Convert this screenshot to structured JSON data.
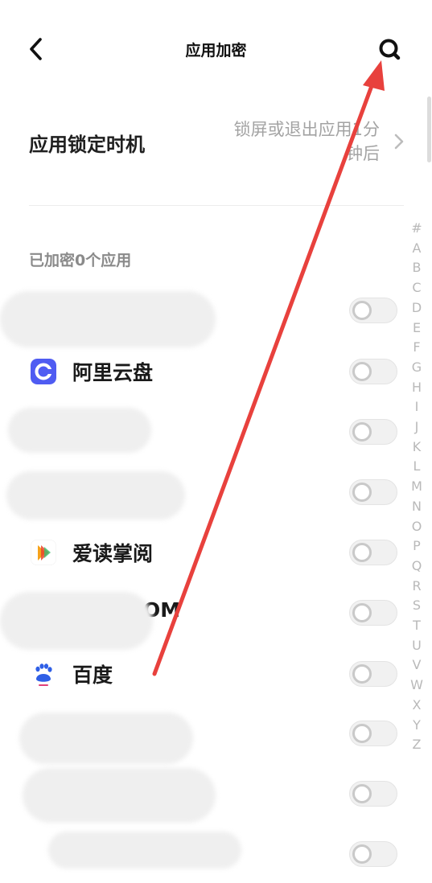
{
  "header": {
    "title": "应用加密",
    "back_icon": "chevron-left-icon",
    "search_icon": "search-icon"
  },
  "lock_timing": {
    "label": "应用锁定时机",
    "value": "锁屏或退出应用1分钟后",
    "value_line1": "锁屏或退出应用1分",
    "value_line2": "钟后"
  },
  "section": {
    "title": "已加密0个应用"
  },
  "apps": [
    {
      "label": "",
      "icon": "green-app-icon",
      "enabled": false,
      "obscured": true
    },
    {
      "label": "阿里云盘",
      "icon": "aliyun-drive-icon",
      "enabled": false,
      "obscured": false
    },
    {
      "label": "",
      "icon": "",
      "enabled": false,
      "obscured": true
    },
    {
      "label": "",
      "icon": "",
      "enabled": false,
      "obscured": true
    },
    {
      "label": "爱读掌阅",
      "icon": "ireader-icon",
      "enabled": false,
      "obscured": false
    },
    {
      "label": "OM",
      "icon": "teal-app-icon",
      "enabled": false,
      "obscured": true
    },
    {
      "label": "百度",
      "icon": "baidu-icon",
      "enabled": false,
      "obscured": false
    },
    {
      "label": "",
      "icon": "",
      "enabled": false,
      "obscured": true
    },
    {
      "label": "",
      "icon": "",
      "enabled": false,
      "obscured": true
    },
    {
      "label": "",
      "icon": "",
      "enabled": false,
      "obscured": true
    }
  ],
  "alpha_index": [
    "#",
    "A",
    "B",
    "C",
    "D",
    "E",
    "F",
    "G",
    "H",
    "I",
    "J",
    "K",
    "L",
    "M",
    "N",
    "O",
    "P",
    "Q",
    "R",
    "S",
    "T",
    "U",
    "V",
    "W",
    "X",
    "Y",
    "Z"
  ],
  "colors": {
    "annotation": "#e8413d",
    "aliyun": "#4f5cf2",
    "baidu": "#2f5fe6"
  }
}
